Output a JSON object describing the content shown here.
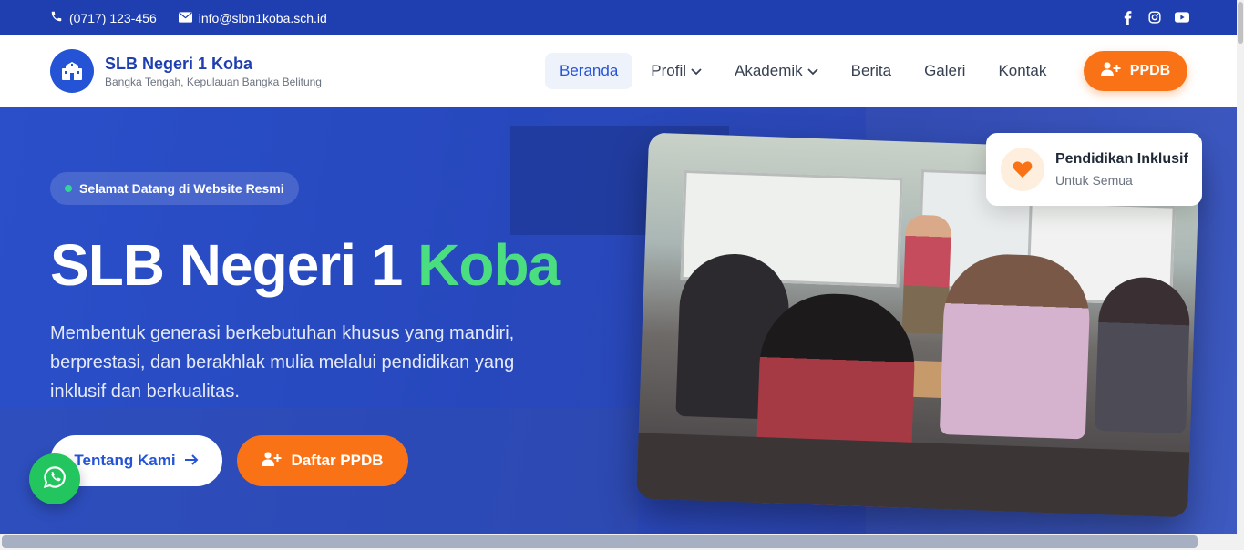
{
  "topbar": {
    "phone": "(0717) 123-456",
    "email": "info@slbn1koba.sch.id",
    "social": [
      "facebook-icon",
      "instagram-icon",
      "youtube-icon"
    ]
  },
  "brand": {
    "name": "SLB Negeri 1 Koba",
    "subtitle": "Bangka Tengah, Kepulauan Bangka Belitung"
  },
  "nav": {
    "items": [
      {
        "label": "Beranda",
        "active": true
      },
      {
        "label": "Profil",
        "dropdown": true
      },
      {
        "label": "Akademik",
        "dropdown": true
      },
      {
        "label": "Berita"
      },
      {
        "label": "Galeri"
      },
      {
        "label": "Kontak"
      }
    ],
    "cta_label": "PPDB"
  },
  "hero": {
    "badge": "Selamat Datang di Website Resmi",
    "title_main": "SLB Negeri 1",
    "title_accent": "Koba",
    "description": "Membentuk generasi berkebutuhan khusus yang mandiri, berprestasi, dan berakhlak mulia melalui pendidikan yang inklusif dan berkualitas.",
    "btn_about": "Tentang Kami",
    "btn_register": "Daftar PPDB"
  },
  "card": {
    "title": "Pendidikan Inklusif",
    "subtitle": "Untuk Semua"
  },
  "colors": {
    "primary": "#2453d6",
    "topbar": "#1f3fb0",
    "accent_orange": "#f97316",
    "accent_green": "#4ade80",
    "whatsapp": "#22c55e"
  }
}
